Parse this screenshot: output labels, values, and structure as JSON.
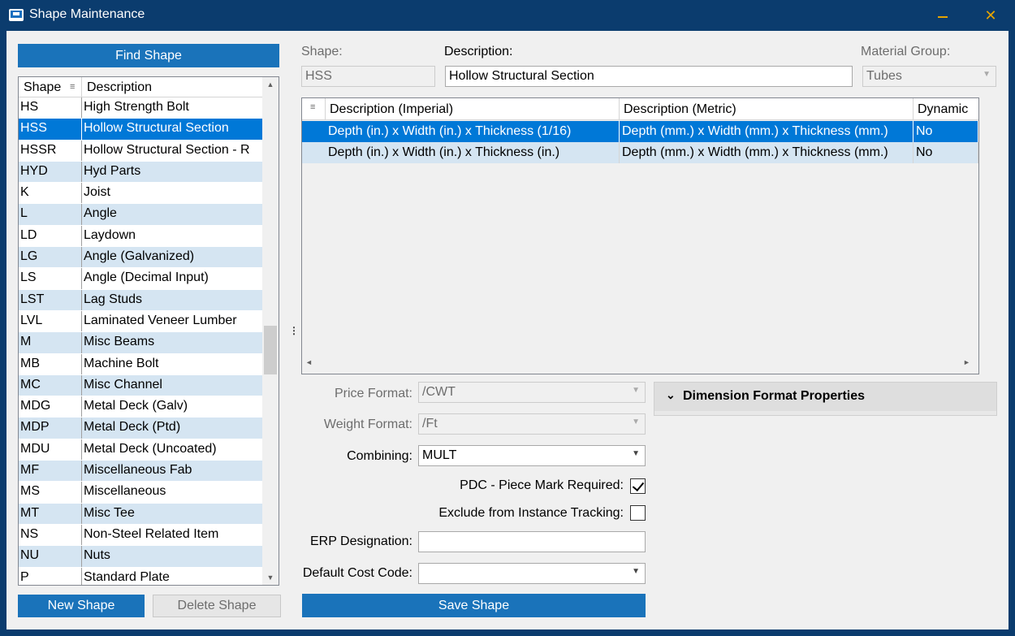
{
  "window": {
    "title": "Shape Maintenance",
    "close_glyph": "✕",
    "icon": "app-monitor-icon"
  },
  "left": {
    "find_button": "Find Shape",
    "columns": {
      "shape": "Shape",
      "description": "Description"
    },
    "rows": [
      {
        "code": "HS",
        "desc": "High Strength Bolt"
      },
      {
        "code": "HSS",
        "desc": "Hollow Structural Section",
        "selected": true
      },
      {
        "code": "HSSR",
        "desc": "Hollow Structural Section - R"
      },
      {
        "code": "HYD",
        "desc": "Hyd Parts"
      },
      {
        "code": "K",
        "desc": "Joist"
      },
      {
        "code": "L",
        "desc": "Angle"
      },
      {
        "code": "LD",
        "desc": "Laydown"
      },
      {
        "code": "LG",
        "desc": "Angle (Galvanized)"
      },
      {
        "code": "LS",
        "desc": "Angle (Decimal Input)"
      },
      {
        "code": "LST",
        "desc": "Lag Studs"
      },
      {
        "code": "LVL",
        "desc": "Laminated Veneer Lumber"
      },
      {
        "code": "M",
        "desc": "Misc Beams"
      },
      {
        "code": "MB",
        "desc": "Machine Bolt"
      },
      {
        "code": "MC",
        "desc": "Misc Channel"
      },
      {
        "code": "MDG",
        "desc": "Metal Deck (Galv)"
      },
      {
        "code": "MDP",
        "desc": "Metal Deck (Ptd)"
      },
      {
        "code": "MDU",
        "desc": "Metal Deck (Uncoated)"
      },
      {
        "code": "MF",
        "desc": "Miscellaneous Fab"
      },
      {
        "code": "MS",
        "desc": "Miscellaneous"
      },
      {
        "code": "MT",
        "desc": "Misc Tee"
      },
      {
        "code": "NS",
        "desc": "Non-Steel Related Item"
      },
      {
        "code": "NU",
        "desc": "Nuts"
      },
      {
        "code": "P",
        "desc": "Standard Plate"
      }
    ],
    "new_button": "New Shape",
    "delete_button": "Delete Shape"
  },
  "form": {
    "shape_label": "Shape:",
    "shape_value": "HSS",
    "description_label": "Description:",
    "description_value": "Hollow Structural Section",
    "material_group_label": "Material Group:",
    "material_group_value": "Tubes"
  },
  "grid": {
    "columns": [
      "Description (Imperial)",
      "Description (Metric)",
      "Dynamic"
    ],
    "rows": [
      {
        "imperial": "Depth (in.) x Width (in.) x Thickness (1/16)",
        "metric": "Depth (mm.) x Width (mm.) x Thickness (mm.)",
        "dynamic": "No",
        "selected": true
      },
      {
        "imperial": "Depth (in.) x Width (in.) x Thickness (in.)",
        "metric": "Depth (mm.) x Width (mm.) x Thickness (mm.)",
        "dynamic": "No"
      }
    ]
  },
  "props": {
    "price_format_label": "Price Format:",
    "price_format_value": "/CWT",
    "weight_format_label": "Weight Format:",
    "weight_format_value": "/Ft",
    "combining_label": "Combining:",
    "combining_value": "MULT",
    "pdc_label": "PDC - Piece Mark Required:",
    "pdc_checked": true,
    "exclude_label": "Exclude from Instance Tracking:",
    "exclude_checked": false,
    "erp_label": "ERP Designation:",
    "erp_value": "",
    "cost_code_label": "Default Cost Code:",
    "cost_code_value": ""
  },
  "dimension_panel": {
    "title": "Dimension Format Properties"
  },
  "save_button": "Save Shape",
  "colors": {
    "titlebar": "#0b3c6e",
    "accent_button": "#1a73ba",
    "selection": "#0078d7",
    "row_alt": "#d5e5f2",
    "window_controls": "#e6a400"
  }
}
